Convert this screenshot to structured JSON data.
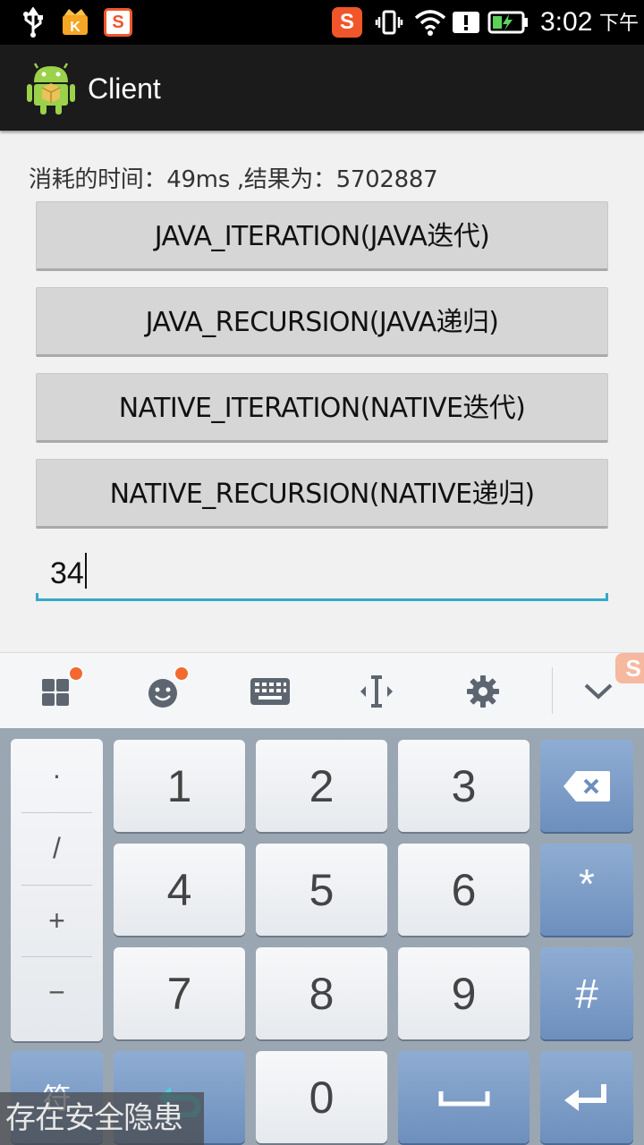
{
  "status_bar": {
    "time": "3:02",
    "ampm": "下午",
    "icons": [
      "usb-icon",
      "kingroot-icon",
      "sogou-icon",
      "sogou-ime-icon",
      "vibrate-icon",
      "wifi-icon",
      "alert-icon",
      "battery-charging-icon"
    ]
  },
  "app": {
    "title": "Client",
    "icon": "android-app-icon"
  },
  "result": {
    "text": "消耗的时间：49ms ,结果为：5702887"
  },
  "buttons": {
    "java_iteration": "JAVA_ITERATION(JAVA迭代)",
    "java_recursion": "JAVA_RECURSION(JAVA递归)",
    "native_iteration": "NATIVE_ITERATION(NATIVE迭代)",
    "native_recursion": "NATIVE_RECURSION(NATIVE递归)"
  },
  "input": {
    "value": "34"
  },
  "keyboard_toolbar": {
    "items": [
      "apps-icon",
      "emoji-icon",
      "keyboard-icon",
      "cursor-icon",
      "settings-icon",
      "collapse-icon"
    ],
    "accent": "#f26a30"
  },
  "keyboard": {
    "symbols": [
      "·",
      "/",
      "+",
      "−"
    ],
    "digits": [
      "1",
      "2",
      "3",
      "4",
      "5",
      "6",
      "7",
      "8",
      "9",
      "0"
    ],
    "star": "*",
    "hash": "#",
    "symbol_switch": "符",
    "space_icon": "space-icon",
    "enter_icon": "enter-icon",
    "back_icon": "back-icon",
    "delete_icon": "backspace-icon"
  },
  "watermark": {
    "text": "存在安全隐患"
  },
  "colors": {
    "action_bar": "#1b1b1b",
    "input_underline": "#33a9c9",
    "key_blue": "#7a9ac6",
    "keyboard_bg": "#9aa6b2"
  }
}
